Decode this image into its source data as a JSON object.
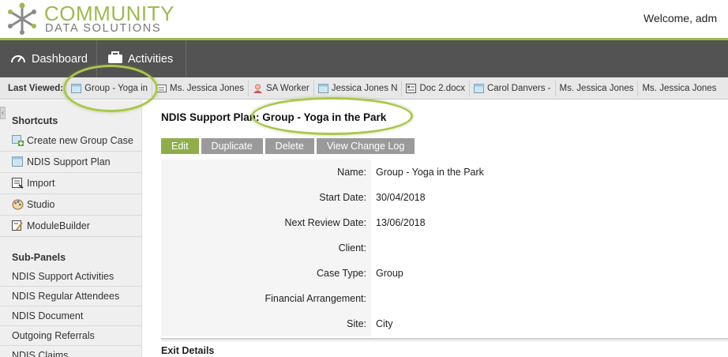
{
  "header": {
    "logo_line1": "COMMUNITY",
    "logo_line2": "DATA SOLUTIONS",
    "welcome": "Welcome, adm"
  },
  "nav": {
    "dashboard": "Dashboard",
    "activities": "Activities"
  },
  "last_viewed": {
    "label": "Last Viewed:",
    "items": [
      {
        "label": "Group - Yoga in",
        "icon": "case-icon"
      },
      {
        "label": "Ms. Jessica Jones",
        "icon": "contact-card-icon"
      },
      {
        "label": "SA Worker",
        "icon": "user-icon"
      },
      {
        "label": "Jessica Jones N",
        "icon": "case-icon"
      },
      {
        "label": "Doc 2.docx",
        "icon": "document-icon"
      },
      {
        "label": "Carol Danvers -",
        "icon": "case-icon"
      },
      {
        "label": "Ms. Jessica Jones",
        "icon": "none"
      },
      {
        "label": "Ms. Jessica Jones",
        "icon": "none"
      }
    ]
  },
  "sidebar": {
    "shortcuts_heading": "Shortcuts",
    "shortcuts": [
      {
        "label": "Create new Group Case",
        "icon": "create-case-icon"
      },
      {
        "label": "NDIS Support Plan",
        "icon": "case-icon"
      },
      {
        "label": "Import",
        "icon": "import-icon"
      },
      {
        "label": "Studio",
        "icon": "studio-palette-icon"
      },
      {
        "label": "ModuleBuilder",
        "icon": "module-builder-icon"
      }
    ],
    "subpanels_heading": "Sub-Panels",
    "subpanels": [
      "NDIS Support Activities",
      "NDIS Regular Attendees",
      "NDIS Document",
      "Outgoing Referrals",
      "NDIS Claims"
    ]
  },
  "main": {
    "title": "NDIS Support Plan: Group - Yoga in the Park",
    "buttons": {
      "edit": "Edit",
      "duplicate": "Duplicate",
      "delete": "Delete",
      "view_change_log": "View Change Log"
    },
    "fields": [
      {
        "label": "Name:",
        "value": "Group - Yoga in the Park"
      },
      {
        "label": "Start Date:",
        "value": "30/04/2018"
      },
      {
        "label": "Next Review Date:",
        "value": "13/06/2018"
      },
      {
        "label": "Client:",
        "value": ""
      },
      {
        "label": "Case Type:",
        "value": "Group"
      },
      {
        "label": "Financial Arrangement:",
        "value": ""
      },
      {
        "label": "Site:",
        "value": "City"
      }
    ],
    "exit_details_heading": "Exit Details"
  },
  "colors": {
    "brand_green": "#9dba4f",
    "nav_bg": "#535353",
    "edit_button": "#8fae4a",
    "secondary_button": "#9a9a9a"
  }
}
